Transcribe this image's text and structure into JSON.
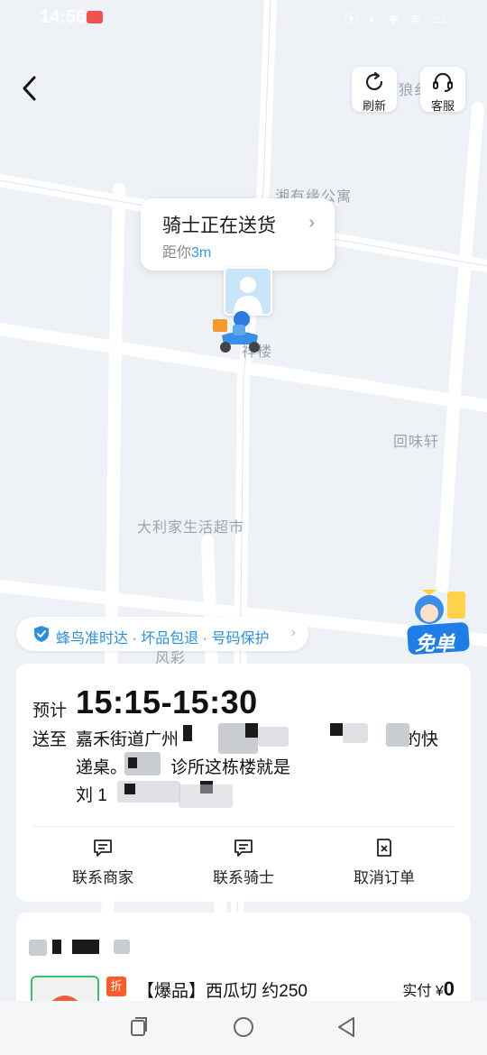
{
  "status_bar": {
    "time": "14:56",
    "icons_text": "⦿ ◐ ✱ ≋ ▭"
  },
  "header": {
    "refresh_label": "刷新",
    "service_label": "客服"
  },
  "map": {
    "labels": [
      "湘有缘公寓",
      "祥楼",
      "回味轩",
      "大利家生活超市",
      "狼纟",
      "风彩"
    ],
    "rider_bubble": {
      "title": "骑士正在送货",
      "distance_prefix": "距你",
      "distance_value": "3m"
    },
    "free_badge_text": "免单"
  },
  "guarantee_banner": {
    "text": "蜂鸟准时达 · 坏品包退 · 号码保护"
  },
  "delivery_card": {
    "eta_prefix": "预计",
    "eta_time": "15:15-15:30",
    "to_label": "送至",
    "address_line1": "嘉禾街道广州",
    "address_line1_tail": "的快",
    "address_line2": "递桌。",
    "address_line2_tail": "诊所这栋楼就是",
    "contact": "刘 1",
    "actions": [
      {
        "label": "联系商家",
        "icon": "message-icon"
      },
      {
        "label": "联系骑士",
        "icon": "message-icon"
      },
      {
        "label": "取消订单",
        "icon": "cancel-order-icon"
      }
    ]
  },
  "order_card": {
    "discount_tag": "折",
    "product_name": "【爆品】西瓜切 约250",
    "paid_label": "实付 ¥",
    "paid_value": "0"
  },
  "nav_bar": {
    "buttons": [
      "recent-apps",
      "home",
      "back"
    ]
  },
  "colors": {
    "accent_blue": "#2a9ee8",
    "map_bg": "#eef2f7",
    "discount_red": "#ff5a2a",
    "free_badge_blue": "#1f7de8"
  }
}
